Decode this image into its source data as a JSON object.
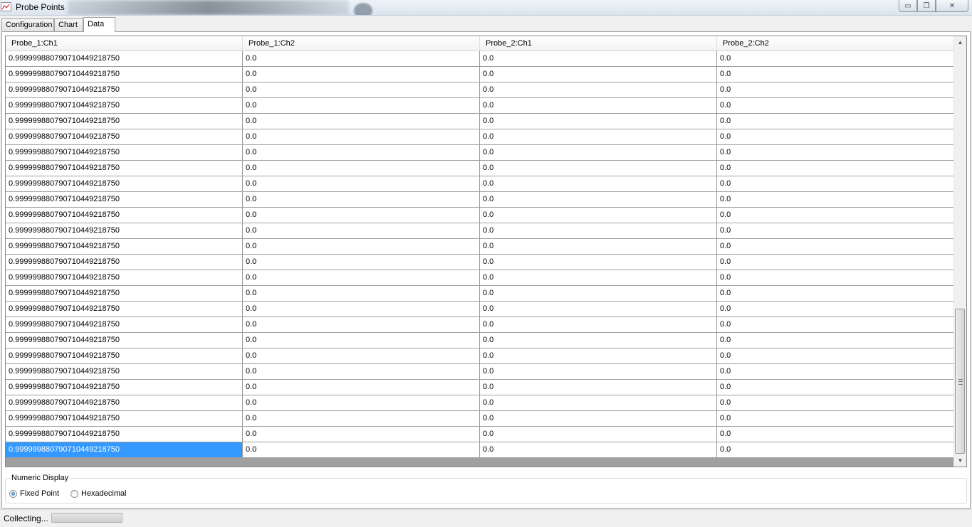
{
  "window": {
    "title": "Probe Points",
    "controls": {
      "minimize": "▭",
      "maximize": "❐",
      "close": "✕"
    }
  },
  "tabs": [
    {
      "label": "Configuration",
      "active": false
    },
    {
      "label": "Chart",
      "active": false
    },
    {
      "label": "Data",
      "active": true
    }
  ],
  "table": {
    "columns": [
      "Probe_1:Ch1",
      "Probe_1:Ch2",
      "Probe_2:Ch1",
      "Probe_2:Ch2"
    ],
    "rows": [
      [
        "0.999999880790710449218750",
        "0.0",
        "0.0",
        "0.0"
      ],
      [
        "0.999999880790710449218750",
        "0.0",
        "0.0",
        "0.0"
      ],
      [
        "0.999999880790710449218750",
        "0.0",
        "0.0",
        "0.0"
      ],
      [
        "0.999999880790710449218750",
        "0.0",
        "0.0",
        "0.0"
      ],
      [
        "0.999999880790710449218750",
        "0.0",
        "0.0",
        "0.0"
      ],
      [
        "0.999999880790710449218750",
        "0.0",
        "0.0",
        "0.0"
      ],
      [
        "0.999999880790710449218750",
        "0.0",
        "0.0",
        "0.0"
      ],
      [
        "0.999999880790710449218750",
        "0.0",
        "0.0",
        "0.0"
      ],
      [
        "0.999999880790710449218750",
        "0.0",
        "0.0",
        "0.0"
      ],
      [
        "0.999999880790710449218750",
        "0.0",
        "0.0",
        "0.0"
      ],
      [
        "0.999999880790710449218750",
        "0.0",
        "0.0",
        "0.0"
      ],
      [
        "0.999999880790710449218750",
        "0.0",
        "0.0",
        "0.0"
      ],
      [
        "0.999999880790710449218750",
        "0.0",
        "0.0",
        "0.0"
      ],
      [
        "0.999999880790710449218750",
        "0.0",
        "0.0",
        "0.0"
      ],
      [
        "0.999999880790710449218750",
        "0.0",
        "0.0",
        "0.0"
      ],
      [
        "0.999999880790710449218750",
        "0.0",
        "0.0",
        "0.0"
      ],
      [
        "0.999999880790710449218750",
        "0.0",
        "0.0",
        "0.0"
      ],
      [
        "0.999999880790710449218750",
        "0.0",
        "0.0",
        "0.0"
      ],
      [
        "0.999999880790710449218750",
        "0.0",
        "0.0",
        "0.0"
      ],
      [
        "0.999999880790710449218750",
        "0.0",
        "0.0",
        "0.0"
      ],
      [
        "0.999999880790710449218750",
        "0.0",
        "0.0",
        "0.0"
      ],
      [
        "0.999999880790710449218750",
        "0.0",
        "0.0",
        "0.0"
      ],
      [
        "0.999999880790710449218750",
        "0.0",
        "0.0",
        "0.0"
      ],
      [
        "0.999999880790710449218750",
        "0.0",
        "0.0",
        "0.0"
      ],
      [
        "0.999999880790710449218750",
        "0.0",
        "0.0",
        "0.0"
      ],
      [
        "0.999999880790710449218750",
        "0.0",
        "0.0",
        "0.0"
      ]
    ],
    "selected_row": 25,
    "selected_col": 0,
    "selection_color": "#3399ff"
  },
  "numeric_display": {
    "label": "Numeric Display",
    "options": [
      {
        "label": "Fixed Point",
        "selected": true
      },
      {
        "label": "Hexadecimal",
        "selected": false
      }
    ]
  },
  "status": {
    "text": "Collecting...",
    "progress": 1.0
  },
  "icons": {
    "app": "chart-window-icon",
    "scroll_up": "scroll-up-arrow-icon",
    "scroll_down": "scroll-down-arrow-icon"
  }
}
